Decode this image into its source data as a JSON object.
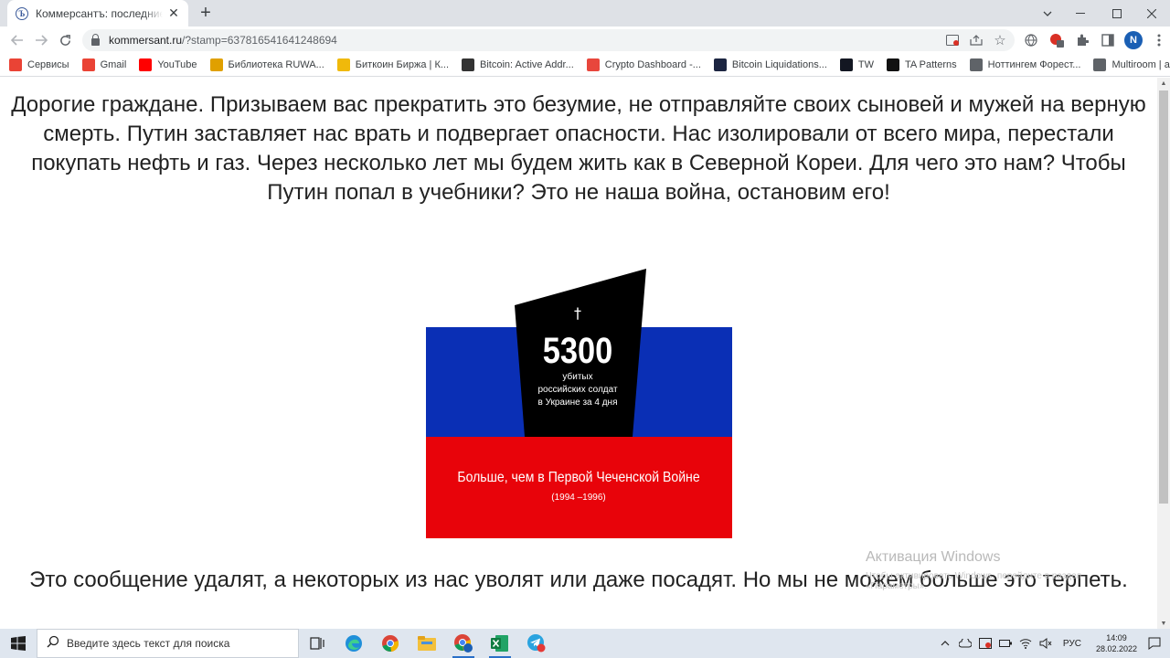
{
  "browser": {
    "tab_title": "Коммерсантъ: последние новости",
    "tab_favicon": "Ъ",
    "url_domain": "kommersant.ru",
    "url_path": "/?stamp=637816541641248694",
    "profile_initial": "N"
  },
  "bookmarks": [
    {
      "label": "Сервисы",
      "icon": "apps-grid-icon",
      "color": "#ea4335"
    },
    {
      "label": "Gmail",
      "icon": "gmail-icon",
      "color": "#ea4335"
    },
    {
      "label": "YouTube",
      "icon": "youtube-icon",
      "color": "#ff0000"
    },
    {
      "label": "Библиотека RUWA...",
      "icon": "ruwa-icon",
      "color": "#e0a000"
    },
    {
      "label": "Биткоин Биржа | К...",
      "icon": "binance-icon",
      "color": "#f0b90b"
    },
    {
      "label": "Bitcoin: Active Addr...",
      "icon": "glassnode-icon",
      "color": "#333333"
    },
    {
      "label": "Crypto Dashboard -...",
      "icon": "crypto-dashboard-icon",
      "color": "#e8463c"
    },
    {
      "label": "Bitcoin Liquidations...",
      "icon": "bybt-icon",
      "color": "#1c2541"
    },
    {
      "label": "TW",
      "icon": "tradingview-icon",
      "color": "#131722"
    },
    {
      "label": "TA Patterns",
      "icon": "ta-patterns-icon",
      "color": "#111111"
    },
    {
      "label": "Ноттингем Форест...",
      "icon": "globe-icon",
      "color": "#5f6368"
    },
    {
      "label": "Multiroom | аренда...",
      "icon": "multiroom-icon",
      "color": "#5f6368"
    }
  ],
  "article": {
    "intro": "Дорогие граждане. Призываем вас прекратить это безумие, не отправляйте своих сыновей и мужей на верную смерть. Путин заставляет нас врать и подвергает опасности. Нас изолировали от всего мира, перестали покупать нефть и газ. Через несколько лет мы будем жить как в Северной Кореи. Для чего это нам? Чтобы Путин попал в учебники? Это не наша война, остановим его!",
    "outro": "Это сообщение удалят, а некоторых из нас уволят или даже посадят. Но мы не можем больше это терпеть."
  },
  "graphic": {
    "cross": "†",
    "number": "5300",
    "caption_line1": "убитых",
    "caption_line2": "российских солдат",
    "caption_line3": "в Украине за 4 дня",
    "bottom_text": "Больше, чем в Первой Чеченской Войне",
    "bottom_years": "(1994 –1996)",
    "colors": {
      "blue": "#0a2fb5",
      "red": "#e8030a",
      "black": "#000000"
    }
  },
  "watermark": {
    "title": "Активация Windows",
    "subtitle": "Чтобы активировать Windows, перейдите в раздел «Параметры»."
  },
  "taskbar": {
    "search_placeholder": "Введите здесь текст для поиска",
    "language": "РУС",
    "time": "14:09",
    "date": "28.02.2022"
  }
}
